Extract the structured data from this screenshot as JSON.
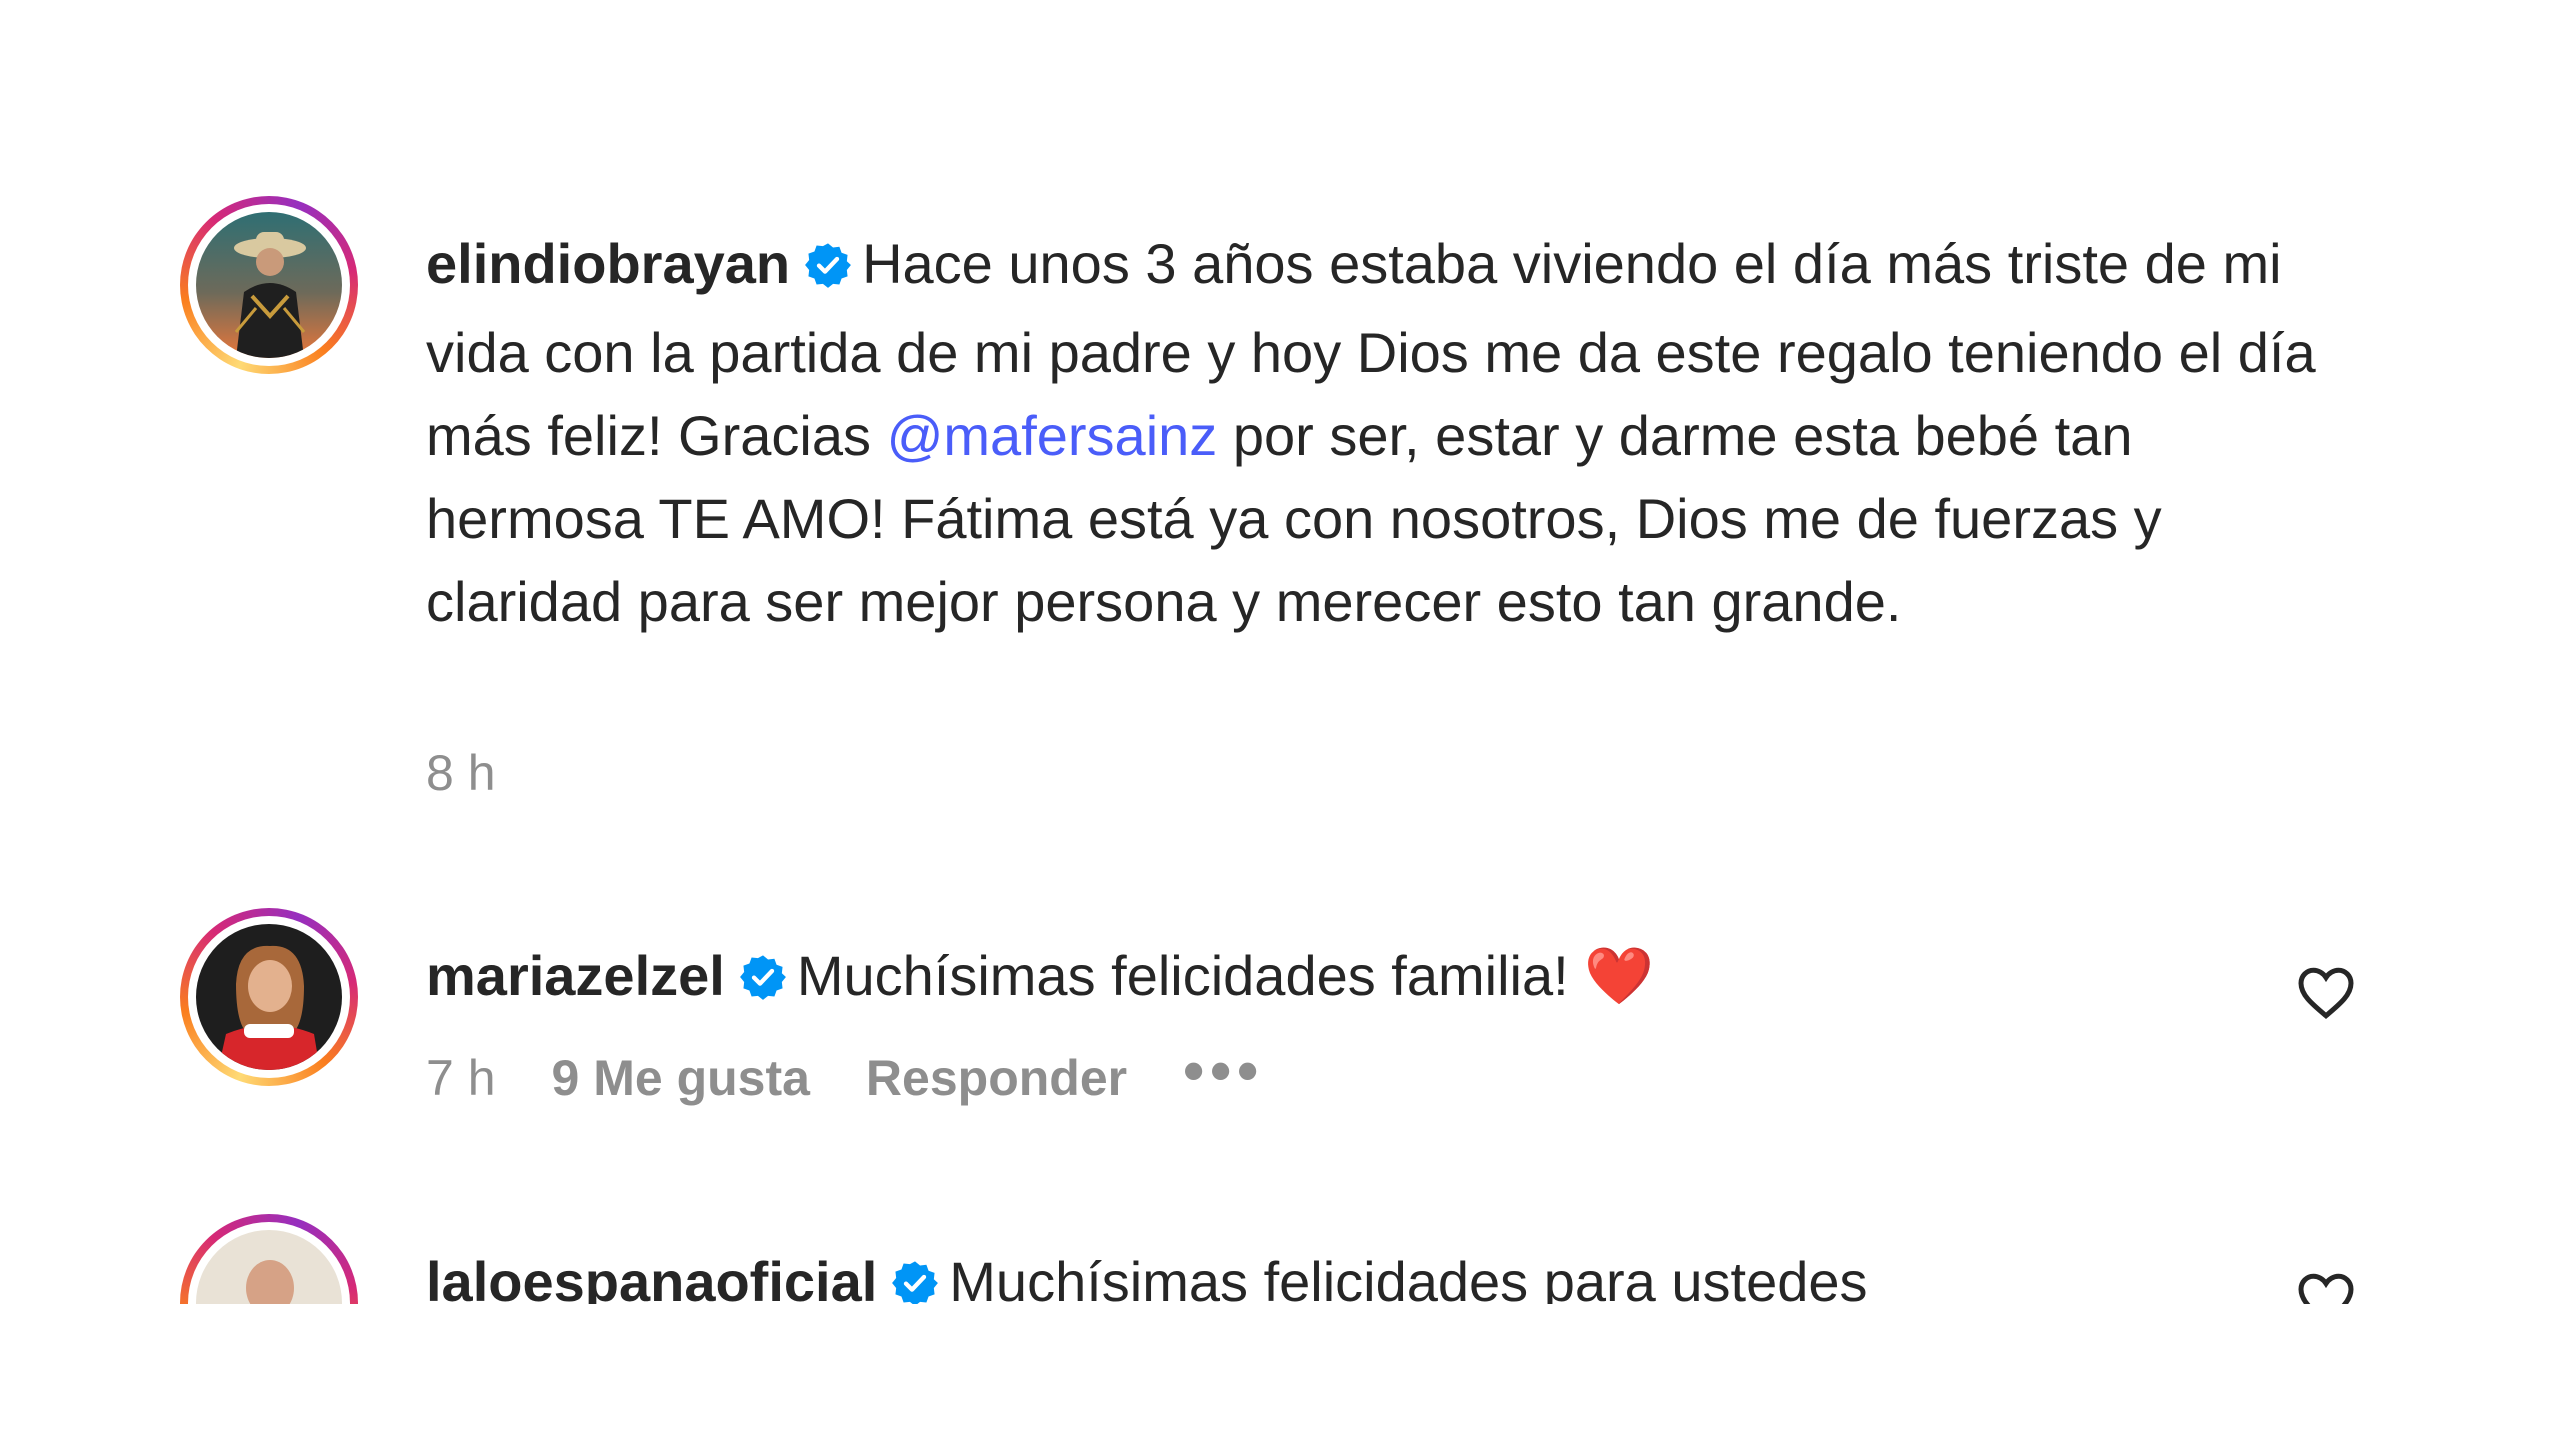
{
  "comments": [
    {
      "username": "elindiobrayan",
      "text_before": "Hace unos 3 años estaba viviendo el día más triste de mi vida con la partida de mi padre y hoy Dios me da este regalo teniendo el día más feliz! Gracias ",
      "mention": "@mafersainz",
      "text_after": " por ser, estar y darme esta bebé tan hermosa TE AMO! Fátima está ya con nosotros, Dios me de fuerzas y claridad para ser mejor persona y merecer esto tan grande.",
      "time": "8 h"
    },
    {
      "username": "mariazelzel",
      "text": "Muchísimas felicidades familia! ",
      "emoji": "❤️",
      "time": "7 h",
      "likes": "9 Me gusta",
      "reply_label": "Responder",
      "more_label": "•••"
    },
    {
      "username": "laloespanaoficial",
      "text": "Muchísimas felicidades para ustedes"
    }
  ],
  "colors": {
    "mention": "#4a5df9",
    "verified": "#0095f6",
    "meta": "#8e8e8e",
    "text": "#262626"
  },
  "icons": {
    "verified": "verified-badge-icon",
    "like": "heart-outline-icon"
  }
}
